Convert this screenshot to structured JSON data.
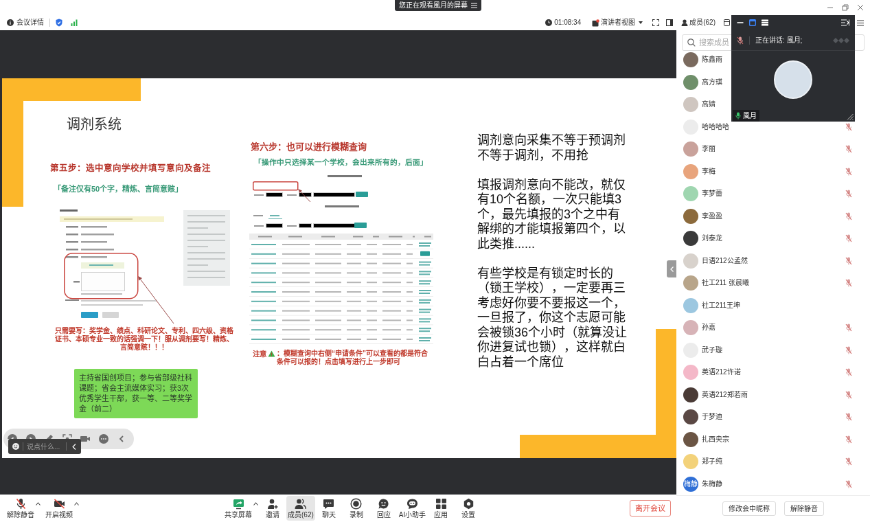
{
  "window": {
    "banner": "您正在观看風月的屏幕"
  },
  "info_bar": {
    "meeting_details": "会议详情",
    "timer": "01:08:34",
    "view_mode": "演讲者视图",
    "members": "成员(62)"
  },
  "slide": {
    "title": "调剂系统",
    "step5": {
      "heading": "第五步：选中意向学校并填写意向及备注",
      "tip": "「备注仅有50个字，精炼、言简意赅」",
      "instruction": "只需要写：奖学金、绩点、科研论文、专利、四六级、资格证书、本硕专业一致的话强调一下！服从调剂要写！精炼、言简意赅！！！",
      "example": "主持省国创项目；参与省部级社科课题；省会主流媒体实习；获3次优秀学生干部，获一等、二等奖学金（前二）"
    },
    "step6": {
      "heading": "第六步：也可以进行模糊查询",
      "tip": "「操作中只选择某一个学校，会出来所有的，后面」",
      "note_label": "注意",
      "note": "：模糊查询中右侧“申请条件”可以查看的都是符合条件可以报的！点击填写进行上一步即可"
    },
    "notes": [
      "调剂意向采集不等于预调剂不等于调剂，不用抢",
      "填报调剂意向不能改，就仅有10个名额，一次只能填3个，最先填报的3个之中有解绑的才能填报第四个，以此类推......",
      "有些学校是有锁定时长的（锁王学校），一定要再三考虑好你要不要报这一个，一旦报了，你这个志愿可能会被锁36个小时（就算没让你进复试也锁），这样就白白占着一个席位"
    ]
  },
  "slide_controls": {
    "chat_placeholder": "说点什么..."
  },
  "speaker_window": {
    "status": "正在讲话: 風月;",
    "name": "風月"
  },
  "members_panel": {
    "search_placeholder": "搜索成员",
    "members": [
      {
        "name": "陈鑫雨",
        "muted": false
      },
      {
        "name": "高方琪",
        "muted": false
      },
      {
        "name": "高婧",
        "muted": false
      },
      {
        "name": "哈哈哈哈",
        "muted": true
      },
      {
        "name": "李丽",
        "muted": true
      },
      {
        "name": "李梅",
        "muted": true
      },
      {
        "name": "李梦蕾",
        "muted": true
      },
      {
        "name": "李盈盈",
        "muted": true
      },
      {
        "name": "刘泰龙",
        "muted": true
      },
      {
        "name": "日语212公孟然",
        "muted": true
      },
      {
        "name": "社工211 张晨曦",
        "muted": true
      },
      {
        "name": "社工211王坤",
        "muted": false
      },
      {
        "name": "孙嘉",
        "muted": true
      },
      {
        "name": "武子璇",
        "muted": true
      },
      {
        "name": "英语212许诺",
        "muted": true
      },
      {
        "name": "英语212郑若雨",
        "muted": true
      },
      {
        "name": "于梦迪",
        "muted": true
      },
      {
        "name": "扎西央宗",
        "muted": true
      },
      {
        "name": "郑子纯",
        "muted": true
      },
      {
        "name": "朱梅静",
        "muted": true,
        "avatar_text": "梅静"
      }
    ],
    "buttons": [
      "修改会中昵称",
      "解除静音"
    ]
  },
  "toolbar": {
    "items": [
      {
        "label": "解除静音",
        "menu": true,
        "selected": false
      },
      {
        "label": "开启视频",
        "menu": true,
        "selected": false
      },
      {
        "label": "共享屏幕",
        "menu": true,
        "selected": false
      },
      {
        "label": "邀请",
        "menu": false,
        "selected": false
      },
      {
        "label": "成员(62)",
        "menu": false,
        "selected": true
      },
      {
        "label": "聊天",
        "menu": false,
        "selected": false
      },
      {
        "label": "录制",
        "menu": false,
        "selected": false
      },
      {
        "label": "回应",
        "menu": false,
        "selected": false
      },
      {
        "label": "AI小助手",
        "menu": false,
        "selected": false
      },
      {
        "label": "应用",
        "menu": false,
        "selected": false
      },
      {
        "label": "设置",
        "menu": false,
        "selected": false
      }
    ],
    "leave": "离开会议"
  }
}
